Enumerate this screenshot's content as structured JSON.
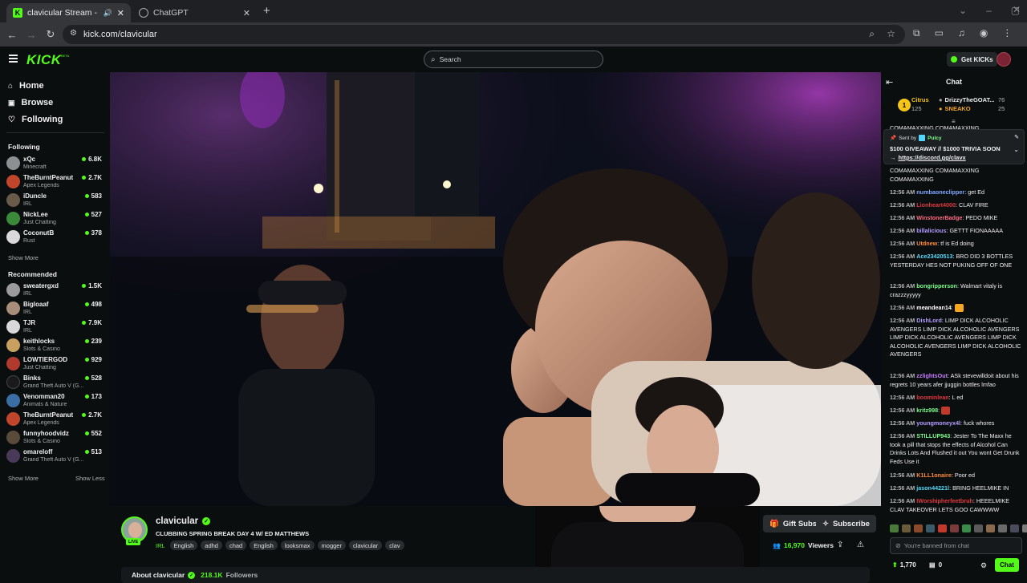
{
  "browser": {
    "tabs": [
      {
        "title": "clavicular Stream - Watch L",
        "active": true
      },
      {
        "title": "ChatGPT",
        "active": false
      }
    ],
    "new_tab": "+",
    "url": "kick.com/clavicular"
  },
  "topnav": {
    "logo": "KICK",
    "logo_badge": "BETA",
    "search_placeholder": "Search",
    "get_kicks": "Get KICKs"
  },
  "sidebar": {
    "nav": [
      {
        "label": "Home",
        "icon": "home-icon"
      },
      {
        "label": "Browse",
        "icon": "browse-icon"
      },
      {
        "label": "Following",
        "icon": "heart-icon"
      }
    ],
    "following_title": "Following",
    "following": [
      {
        "name": "xQc",
        "category": "Minecraft",
        "viewers": "6.8K"
      },
      {
        "name": "TheBurntPeanut",
        "category": "Apex Legends",
        "viewers": "2.7K"
      },
      {
        "name": "iDuncle",
        "category": "IRL",
        "viewers": "583"
      },
      {
        "name": "NickLee",
        "category": "Just Chatting",
        "viewers": "527"
      },
      {
        "name": "CoconutB",
        "category": "Rust",
        "viewers": "378"
      }
    ],
    "show_more_1": "Show More",
    "recommended_title": "Recommended",
    "recommended": [
      {
        "name": "sweatergxd",
        "category": "IRL",
        "viewers": "1.5K"
      },
      {
        "name": "Bigloaaf",
        "category": "IRL",
        "viewers": "498"
      },
      {
        "name": "TJR",
        "category": "IRL",
        "viewers": "7.9K"
      },
      {
        "name": "keithlocks",
        "category": "Slots & Casino",
        "viewers": "239"
      },
      {
        "name": "LOWTIERGOD",
        "category": "Just Chatting",
        "viewers": "929"
      },
      {
        "name": "Binks",
        "category": "Grand Theft Auto V (G...",
        "viewers": "528"
      },
      {
        "name": "Venomman20",
        "category": "Animals & Nature",
        "viewers": "173"
      },
      {
        "name": "TheBurntPeanut",
        "category": "Apex Legends",
        "viewers": "2.7K"
      },
      {
        "name": "funnyhoodvidz",
        "category": "Slots & Casino",
        "viewers": "552"
      },
      {
        "name": "omareloff",
        "category": "Grand Theft Auto V (G...",
        "viewers": "513"
      }
    ],
    "show_more_2": "Show More",
    "show_less": "Show Less"
  },
  "stream": {
    "username": "clavicular",
    "live_badge": "LIVE",
    "title": "CLUBBING SPRING BREAK DAY 4 W/ ED MATTHEWS",
    "category": "IRL",
    "tags": [
      "English",
      "adhd",
      "chad",
      "English",
      "looksmax",
      "mogger",
      "clavicular",
      "clav"
    ],
    "gift_subs": "Gift Subs",
    "subscribe": "Subscribe",
    "viewers": "16,970",
    "viewers_label": "Viewers",
    "about_label": "About clavicular",
    "followers": "218.1K",
    "followers_label": "Followers"
  },
  "chat": {
    "title": "Chat",
    "leaderboard": [
      {
        "name": "Citrus",
        "value": "125",
        "color": "#f5c518"
      },
      {
        "name": "DrizzyTheGOAT...",
        "value": "76"
      },
      {
        "name": "SNEAKO",
        "value": "25",
        "color": "#f5a623"
      }
    ],
    "rank": "1",
    "pinned_sender_label": "Sent by",
    "pinned_sender": "Pulcy",
    "pinned_text": "$100 GIVEAWAY // $1000 TRIVIA SOON",
    "pinned_link_arrow": "→",
    "pinned_link": "https://discord.gg/clavx",
    "top_spam_1": "COMAMAXXING COMAMAXXING",
    "top_spam_2": "COMAMAXXING COMAMAXXING",
    "top_spam_3": "COMAMAXXING",
    "messages": [
      {
        "time": "12:56 AM",
        "user": "numbaoneclipper",
        "color": "#7da7ff",
        "text": "get Ed"
      },
      {
        "time": "12:56 AM",
        "user": "Lionheart4000",
        "color": "#e0393e",
        "text": "CLAV FIRE"
      },
      {
        "time": "12:56 AM",
        "user": "WinstonerBadge",
        "color": "#ff6b81",
        "text": "PEDO MIKE"
      },
      {
        "time": "12:56 AM",
        "user": "billalicious",
        "color": "#b39dff",
        "text": "GETTT FIONAAAAA"
      },
      {
        "time": "12:56 AM",
        "user": "Utdnew",
        "color": "#ff8a3d",
        "text": "tf is Ed doing"
      },
      {
        "time": "12:56 AM",
        "user": "Ace23420513",
        "color": "#53d8fb",
        "text": "BRO DID 3 BOTTLES YESTERDAY HES NOT PUKING OFF OF ONE"
      },
      {
        "time": "12:56 AM",
        "user": "bongripperson",
        "color": "#7cfc8a",
        "text": "Walmart vitaly is crazzzyyyyy"
      },
      {
        "time": "12:56 AM",
        "user": "meandean14",
        "color": "#ffffff",
        "text": ""
      },
      {
        "time": "12:56 AM",
        "user": "DishLord",
        "color": "#b39dff",
        "text": "LIMP DICK ALCOHOLIC AVENGERS LIMP DICK ALCOHOLIC AVENGERS LIMP DICK ALCOHOLIC AVENGERS LIMP DICK ALCOHOLIC AVENGERS LIMP DICK ALCOHOLIC AVENGERS"
      },
      {
        "time": "12:56 AM",
        "user": "zzlightsOut",
        "color": "#c77dff",
        "text": "ASk stevewilldoit about his regrets 10 years afer jjuggin bottles lmfao"
      },
      {
        "time": "12:56 AM",
        "user": "boominlean",
        "color": "#e0393e",
        "text": "L ed"
      },
      {
        "time": "12:56 AM",
        "user": "kritz998",
        "color": "#7cfc8a",
        "text": ""
      },
      {
        "time": "12:56 AM",
        "user": "youngmoneyx4l",
        "color": "#b39dff",
        "text": "fuck whores"
      },
      {
        "time": "12:56 AM",
        "user": "STILLUP943",
        "color": "#7cfc8a",
        "text": "Jester To The Maxx he took a pill that stops the effects of Alcohol Can Drinks Lots And Flushed it out You wont Get Drunk Feds Use it"
      },
      {
        "time": "12:56 AM",
        "user": "K1LL1onaire",
        "color": "#ff8a3d",
        "text": "Poor ed"
      },
      {
        "time": "12:56 AM",
        "user": "jason44221l",
        "color": "#53d8fb",
        "text": "BRING HEELMIKE IN"
      },
      {
        "time": "12:56 AM",
        "user": "IWorshipherfeetbruh",
        "color": "#e0393e",
        "text": "HEEELMIKE CLAV TAKEOVER LETS GOO CAWWWW"
      }
    ],
    "input_placeholder": "You're banned from chat",
    "kicks_count": "1,770",
    "zero_count": "0",
    "chat_button": "Chat"
  }
}
